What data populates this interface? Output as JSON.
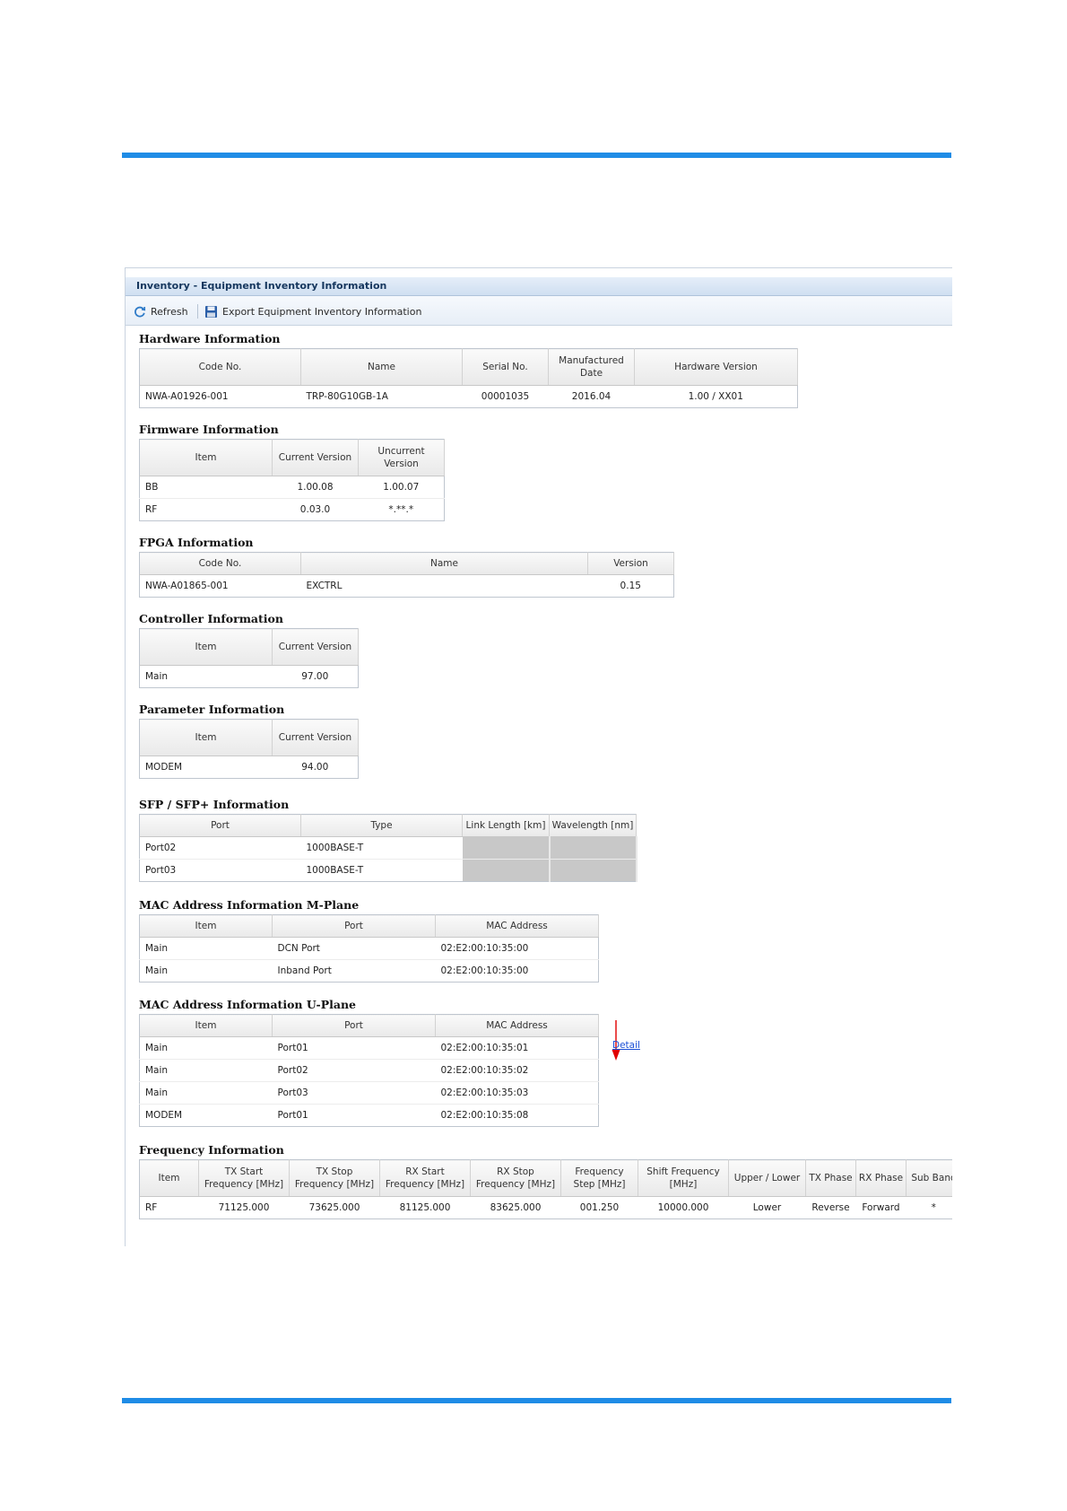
{
  "window": {
    "title": "Inventory - Equipment Inventory Information"
  },
  "toolbar": {
    "refresh_label": "Refresh",
    "export_label": "Export Equipment Inventory Information"
  },
  "hardware": {
    "title": "Hardware Information",
    "headers": [
      "Code No.",
      "Name",
      "Serial No.",
      "Manufactured Date",
      "Hardware Version"
    ],
    "rows": [
      [
        "NWA-A01926-001",
        "TRP-80G10GB-1A",
        "00001035",
        "2016.04",
        "1.00 / XX01"
      ]
    ]
  },
  "firmware": {
    "title": "Firmware Information",
    "headers": [
      "Item",
      "Current Version",
      "Uncurrent Version"
    ],
    "rows": [
      [
        "BB",
        "1.00.08",
        "1.00.07"
      ],
      [
        "RF",
        "0.03.0",
        "*.**.*"
      ]
    ]
  },
  "fpga": {
    "title": "FPGA Information",
    "headers": [
      "Code No.",
      "Name",
      "Version"
    ],
    "rows": [
      [
        "NWA-A01865-001",
        "EXCTRL",
        "0.15"
      ]
    ]
  },
  "controller": {
    "title": "Controller Information",
    "headers": [
      "Item",
      "Current Version"
    ],
    "rows": [
      [
        "Main",
        "97.00"
      ]
    ]
  },
  "parameter": {
    "title": "Parameter Information",
    "headers": [
      "Item",
      "Current Version"
    ],
    "rows": [
      [
        "MODEM",
        "94.00"
      ]
    ]
  },
  "sfp": {
    "title": "SFP / SFP+ Information",
    "detail_link": "Detail",
    "headers": [
      "Port",
      "Type",
      "Link Length [km]",
      "Wavelength [nm]"
    ],
    "rows": [
      [
        "Port02",
        "1000BASE-T",
        "",
        ""
      ],
      [
        "Port03",
        "1000BASE-T",
        "",
        ""
      ]
    ]
  },
  "mac_m": {
    "title": "MAC Address Information M-Plane",
    "headers": [
      "Item",
      "Port",
      "MAC Address"
    ],
    "rows": [
      [
        "Main",
        "DCN Port",
        "02:E2:00:10:35:00"
      ],
      [
        "Main",
        "Inband Port",
        "02:E2:00:10:35:00"
      ]
    ]
  },
  "mac_u": {
    "title": "MAC Address Information U-Plane",
    "headers": [
      "Item",
      "Port",
      "MAC Address"
    ],
    "rows": [
      [
        "Main",
        "Port01",
        "02:E2:00:10:35:01"
      ],
      [
        "Main",
        "Port02",
        "02:E2:00:10:35:02"
      ],
      [
        "Main",
        "Port03",
        "02:E2:00:10:35:03"
      ],
      [
        "MODEM",
        "Port01",
        "02:E2:00:10:35:08"
      ]
    ]
  },
  "frequency": {
    "title": "Frequency Information",
    "headers": [
      "Item",
      "TX Start Frequency [MHz]",
      "TX Stop Frequency [MHz]",
      "RX Start Frequency [MHz]",
      "RX Stop Frequency [MHz]",
      "Frequency Step [MHz]",
      "Shift Frequency [MHz]",
      "Upper / Lower",
      "TX Phase",
      "RX Phase",
      "Sub Band"
    ],
    "rows": [
      [
        "RF",
        "71125.000",
        "73625.000",
        "81125.000",
        "83625.000",
        "001.250",
        "10000.000",
        "Lower",
        "Reverse",
        "Forward",
        "*"
      ]
    ]
  },
  "colors": {
    "rule": "#1f8ce6",
    "title_text": "#16375e",
    "link": "#1a4fd6",
    "arrow": "#e00000",
    "empty_cell": "#c8c8c8"
  },
  "icons": [
    "refresh-icon",
    "save-disk-icon",
    "red-arrow-annotation"
  ]
}
